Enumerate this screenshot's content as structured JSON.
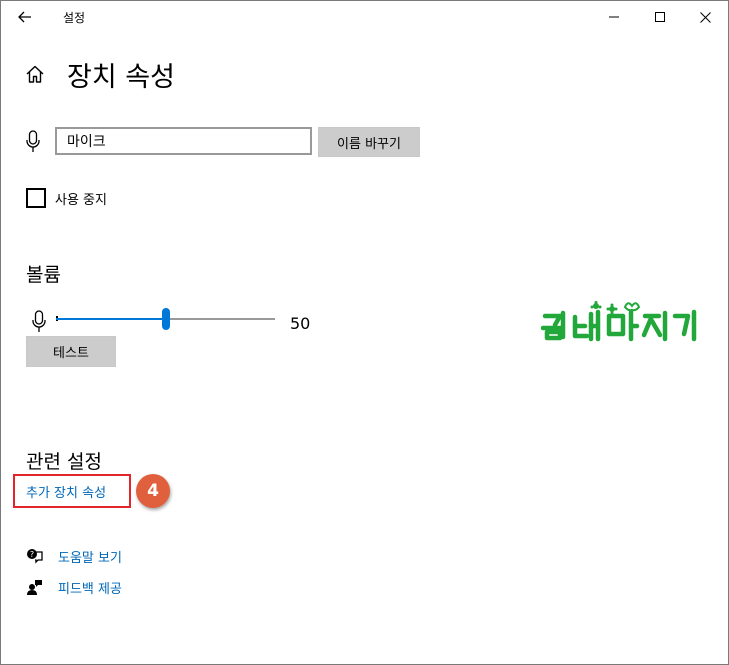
{
  "window": {
    "title": "설정",
    "minimize_label": "minimize",
    "maximize_label": "maximize",
    "close_label": "close"
  },
  "page": {
    "title": "장치 속성"
  },
  "device": {
    "name_value": "마이크",
    "rename_label": "이름 바꾸기",
    "disable_label": "사용 중지",
    "disable_checked": false
  },
  "volume": {
    "heading": "볼륨",
    "value": "50",
    "level": 50,
    "test_label": "테스트"
  },
  "watermark": {
    "text": "컴테마지기",
    "color": "#22a83a"
  },
  "related": {
    "heading": "관련 설정",
    "link_label": "추가 장치 속성",
    "step_badge": "4",
    "highlight_color": "#e3262b",
    "badge_color": "#e0603e"
  },
  "help": {
    "items": [
      {
        "label": "도움말 보기",
        "icon": "help-chat-icon"
      },
      {
        "label": "피드백 제공",
        "icon": "feedback-icon"
      }
    ]
  },
  "colors": {
    "accent": "#0078d7",
    "link": "#0067b8"
  }
}
